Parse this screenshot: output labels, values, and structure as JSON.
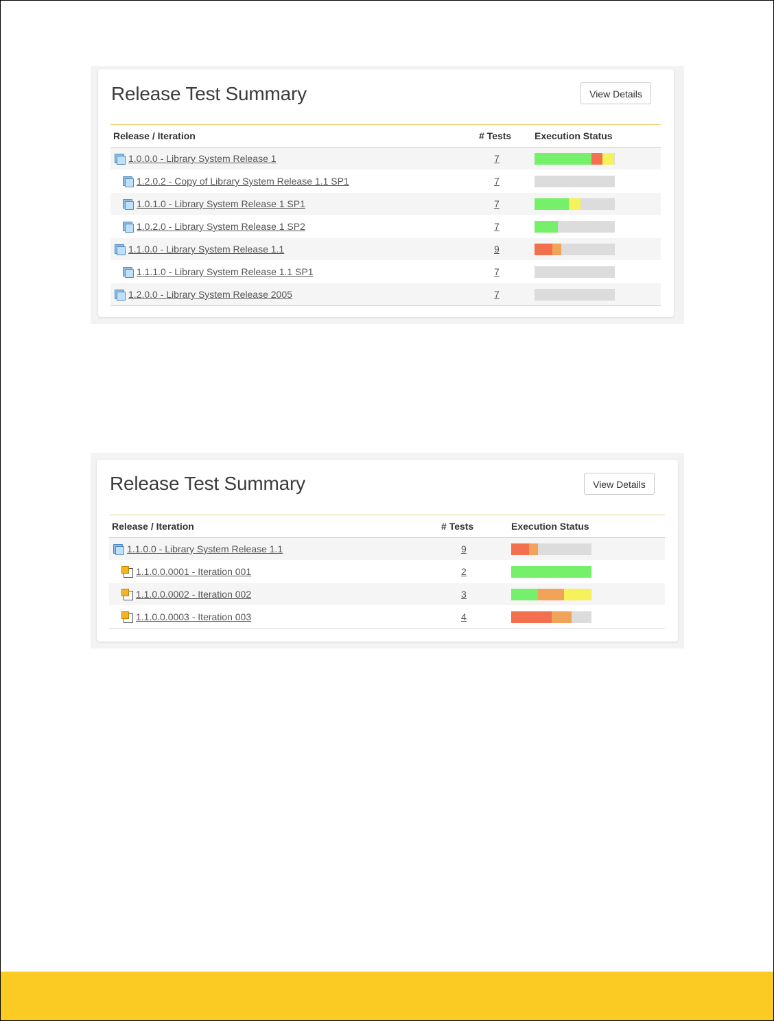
{
  "colors": {
    "passed": "#76f06a",
    "failed": "#f2704e",
    "blocked": "#f2a35a",
    "caution": "#f5f25a",
    "not_run": "#dcdcdc",
    "footer": "#fbcb24"
  },
  "widgets": [
    {
      "title": "Release Test Summary",
      "view_details": "View Details",
      "columns": [
        "Release / Iteration",
        "# Tests",
        "Execution Status"
      ],
      "rows": [
        {
          "icon": "release-icon",
          "indent": 0,
          "name": "1.0.0.0 - Library System Release 1",
          "tests": "7",
          "status": {
            "passed": 0.71,
            "failed": 0.14,
            "blocked": 0,
            "caution": 0.14
          }
        },
        {
          "icon": "release-icon",
          "indent": 1,
          "name": "1.2.0.2 - Copy of Library System Release 1.1 SP1",
          "tests": "7",
          "status": {
            "passed": 0,
            "failed": 0,
            "blocked": 0,
            "caution": 0
          }
        },
        {
          "icon": "release-icon",
          "indent": 1,
          "name": "1.0.1.0 - Library System Release 1 SP1",
          "tests": "7",
          "status": {
            "passed": 0.43,
            "failed": 0,
            "blocked": 0,
            "caution": 0.14
          }
        },
        {
          "icon": "release-icon",
          "indent": 1,
          "name": "1.0.2.0 - Library System Release 1 SP2",
          "tests": "7",
          "status": {
            "passed": 0.29,
            "failed": 0,
            "blocked": 0,
            "caution": 0
          }
        },
        {
          "icon": "release-icon",
          "indent": 0,
          "name": "1.1.0.0 - Library System Release 1.1",
          "tests": "9",
          "status": {
            "passed": 0,
            "failed": 0.22,
            "blocked": 0.11,
            "caution": 0
          }
        },
        {
          "icon": "release-icon",
          "indent": 1,
          "name": "1.1.1.0 - Library System Release 1.1 SP1",
          "tests": "7",
          "status": {
            "passed": 0,
            "failed": 0,
            "blocked": 0,
            "caution": 0
          }
        },
        {
          "icon": "release-icon",
          "indent": 0,
          "name": "1.2.0.0 - Library System Release 2005",
          "tests": "7",
          "status": {
            "passed": 0,
            "failed": 0,
            "blocked": 0,
            "caution": 0
          }
        }
      ]
    },
    {
      "title": "Release Test Summary",
      "view_details": "View Details",
      "columns": [
        "Release / Iteration",
        "# Tests",
        "Execution Status"
      ],
      "rows": [
        {
          "icon": "release-icon",
          "indent": 0,
          "name": "1.1.0.0 - Library System Release 1.1",
          "tests": "9",
          "status": {
            "passed": 0,
            "failed": 0.22,
            "blocked": 0.11,
            "caution": 0
          }
        },
        {
          "icon": "iteration-icon",
          "indent": 1,
          "name": "1.1.0.0.0001 - Iteration 001",
          "tests": "2",
          "status": {
            "passed": 1.0,
            "failed": 0,
            "blocked": 0,
            "caution": 0
          }
        },
        {
          "icon": "iteration-icon",
          "indent": 1,
          "name": "1.1.0.0.0002 - Iteration 002",
          "tests": "3",
          "status": {
            "passed": 0.33,
            "failed": 0,
            "blocked": 0.33,
            "caution": 0.33
          }
        },
        {
          "icon": "iteration-icon",
          "indent": 1,
          "name": "1.1.0.0.0003 - Iteration 003",
          "tests": "4",
          "status": {
            "passed": 0,
            "failed": 0.5,
            "blocked": 0.25,
            "caution": 0
          }
        }
      ]
    }
  ]
}
